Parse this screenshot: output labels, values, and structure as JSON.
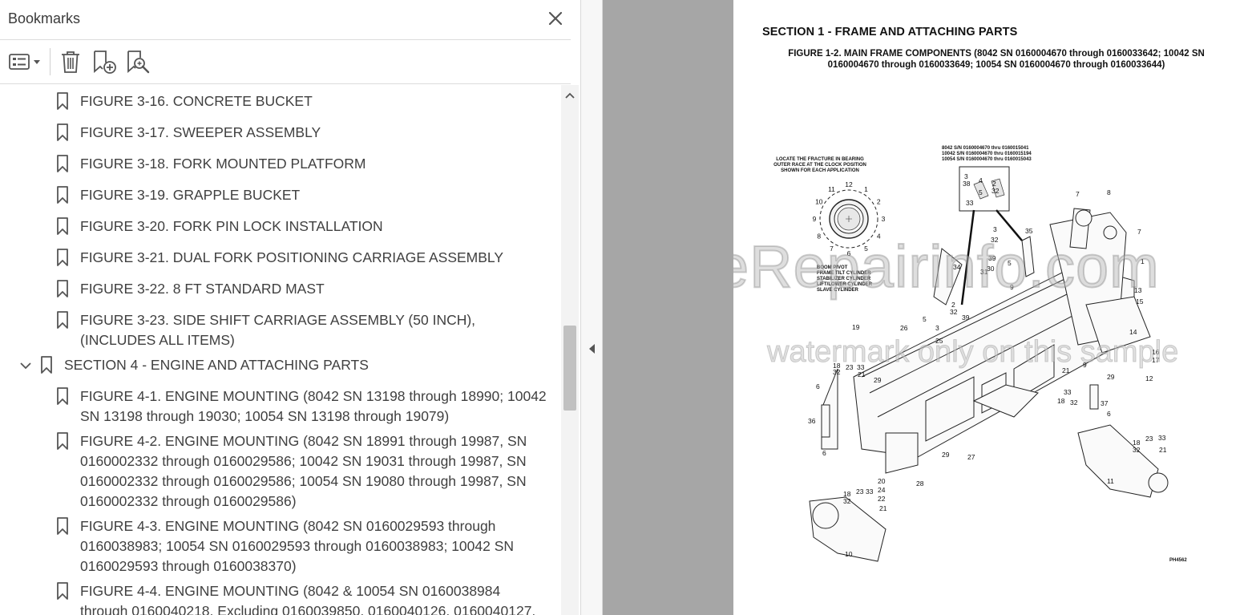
{
  "panel": {
    "title": "Bookmarks",
    "toolbar": {
      "options_icon": "list-options-icon",
      "delete_icon": "trash-icon",
      "new_bookmark_icon": "add-bookmark-icon",
      "find_bookmark_icon": "find-bookmark-icon"
    },
    "items": [
      {
        "label": "FIGURE 3-16. CONCRETE BUCKET",
        "level": 2
      },
      {
        "label": "FIGURE 3-17. SWEEPER ASSEMBLY",
        "level": 2
      },
      {
        "label": "FIGURE 3-18. FORK MOUNTED PLATFORM",
        "level": 2
      },
      {
        "label": "FIGURE 3-19. GRAPPLE BUCKET",
        "level": 2
      },
      {
        "label": "FIGURE 3-20. FORK PIN LOCK INSTALLATION",
        "level": 2
      },
      {
        "label": "FIGURE 3-21. DUAL FORK POSITIONING CARRIAGE ASSEMBLY",
        "level": 2
      },
      {
        "label": "FIGURE 3-22. 8 FT STANDARD MAST",
        "level": 2
      },
      {
        "label": "FIGURE 3-23. SIDE SHIFT CARRIAGE ASSEMBLY (50 INCH), (INCLUDES ALL ITEMS)",
        "level": 2
      },
      {
        "label": "SECTION 4 - ENGINE AND ATTACHING PARTS",
        "level": 1,
        "expanded": true
      },
      {
        "label": "FIGURE 4-1. ENGINE MOUNTING (8042 SN 13198 through 18990; 10042 SN 13198 through 19030; 10054 SN 13198 through 19079)",
        "level": 2
      },
      {
        "label": "FIGURE 4-2. ENGINE MOUNTING (8042 SN 18991 through 19987, SN 0160002332 through 0160029586; 10042 SN 19031 through 19987, SN 0160002332 through 0160029586; 10054 SN 19080 through 19987, SN 0160002332 through 0160029586)",
        "level": 2
      },
      {
        "label": "FIGURE 4-3. ENGINE MOUNTING (8042 SN 0160029593 through 0160038983; 10054 SN 0160029593 through 0160038983; 10042 SN 0160029593 through 0160038370)",
        "level": 2
      },
      {
        "label": "FIGURE 4-4. ENGINE MOUNTING (8042 & 10054 SN 0160038984 through 0160040218, Excluding 0160039850, 0160040126, 0160040127,",
        "level": 2
      }
    ]
  },
  "document": {
    "section_title": "SECTION 1 - FRAME AND ATTACHING PARTS",
    "figure_caption": "FIGURE 1-2. MAIN FRAME COMPONENTS (8042 SN 0160004670 through 0160033642; 10042 SN 0160004670 through 0160033649; 10054 SN 0160004670 through 0160033644)",
    "clock_note": [
      "LOCATE THE FRACTURE IN BEARING",
      "OUTER RACE AT THE CLOCK POSITION",
      "SHOWN FOR EACH APPLICATION"
    ],
    "clock_numbers": [
      "12",
      "1",
      "2",
      "3",
      "4",
      "5",
      "6",
      "7",
      "8",
      "9",
      "10",
      "11"
    ],
    "application_list": [
      "BOOM PIVOT",
      "FRAME TILT CYLINDER",
      "STABILIZER CYLINDER",
      "LIFT/LOWER CYLINDER",
      "SLAVE CYLINDER"
    ],
    "serial_note": [
      "8042 S/N 0160004670 thru 0160015041",
      "10042 S/N 0160004670 thru 0160015194",
      "10054 S/N 0160004670 thru 0160015043"
    ],
    "figure_code": "PH4562",
    "watermark": "eRepairinfo.com",
    "watermark_note": "watermark only on this sample"
  }
}
